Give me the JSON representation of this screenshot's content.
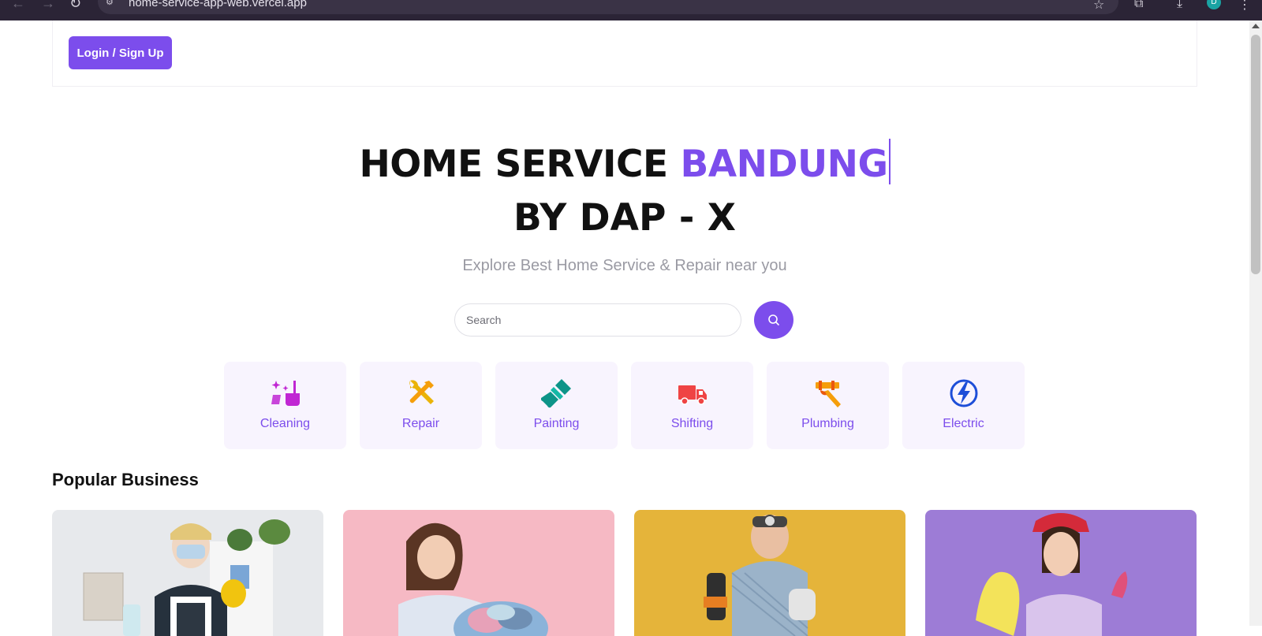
{
  "browser": {
    "url": "home-service-app-web.vercel.app",
    "profile_initial": "D"
  },
  "header": {
    "login_label": "Login / Sign Up"
  },
  "hero": {
    "title_main": "HOME SERVICE ",
    "title_accent": "BANDUNG",
    "title_line2": "BY DAP - X",
    "subtitle": "Explore Best Home Service & Repair near you"
  },
  "search": {
    "placeholder": "Search"
  },
  "categories": [
    {
      "label": "Cleaning",
      "icon": "cleaning-icon",
      "color": "#c026d3"
    },
    {
      "label": "Repair",
      "icon": "repair-tools-icon",
      "color": "#eab308"
    },
    {
      "label": "Painting",
      "icon": "paint-brush-icon",
      "color": "#0d9488"
    },
    {
      "label": "Shifting",
      "icon": "truck-icon",
      "color": "#ef4444"
    },
    {
      "label": "Plumbing",
      "icon": "plumbing-icon",
      "color": "#f59e0b"
    },
    {
      "label": "Electric",
      "icon": "lightning-icon",
      "color": "#1d4ed8"
    }
  ],
  "section": {
    "popular_title": "Popular Business"
  },
  "colors": {
    "accent": "#7c4dec",
    "category_bg": "#f8f4fe"
  }
}
